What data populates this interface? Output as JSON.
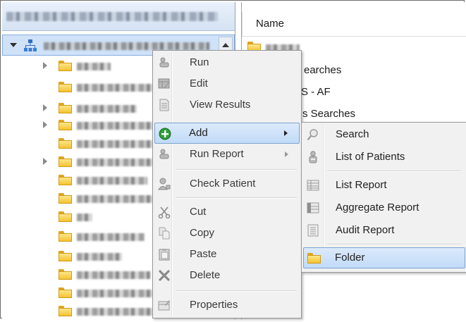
{
  "list": {
    "column_header": "Name",
    "items": [
      "earches",
      "S - AF",
      "s Searches"
    ]
  },
  "context_menu": {
    "items": [
      {
        "label": "Run",
        "icon": "run-icon",
        "enabled": false
      },
      {
        "label": "Edit",
        "icon": "edit-icon",
        "enabled": false
      },
      {
        "label": "View Results",
        "icon": "document-icon",
        "enabled": false
      },
      {
        "label": "Add",
        "icon": "add-plus-icon",
        "enabled": true,
        "highlighted": true,
        "has_submenu": true
      },
      {
        "label": "Run Report",
        "icon": "run-report-icon",
        "enabled": false,
        "has_submenu": true
      },
      {
        "label": "Check Patient",
        "icon": "user-check-icon",
        "enabled": false
      },
      {
        "label": "Cut",
        "icon": "scissors-icon",
        "enabled": false
      },
      {
        "label": "Copy",
        "icon": "copy-icon",
        "enabled": false
      },
      {
        "label": "Paste",
        "icon": "paste-icon",
        "enabled": false
      },
      {
        "label": "Delete",
        "icon": "delete-x-icon",
        "enabled": false
      },
      {
        "label": "Properties",
        "icon": "properties-icon",
        "enabled": false
      }
    ]
  },
  "submenu": {
    "items": [
      {
        "label": "Search",
        "icon": "search-icon"
      },
      {
        "label": "List of Patients",
        "icon": "patients-icon"
      },
      {
        "label": "List Report",
        "icon": "list-report-icon"
      },
      {
        "label": "Aggregate Report",
        "icon": "aggregate-report-icon"
      },
      {
        "label": "Audit Report",
        "icon": "audit-report-icon"
      },
      {
        "label": "Folder",
        "icon": "folder-icon",
        "highlighted": true
      }
    ]
  },
  "colors": {
    "highlight_bg": "#c1dbf8",
    "highlight_border": "#7da2ce",
    "folder_yellow": "#f5c331",
    "add_green": "#2f9e3a"
  }
}
